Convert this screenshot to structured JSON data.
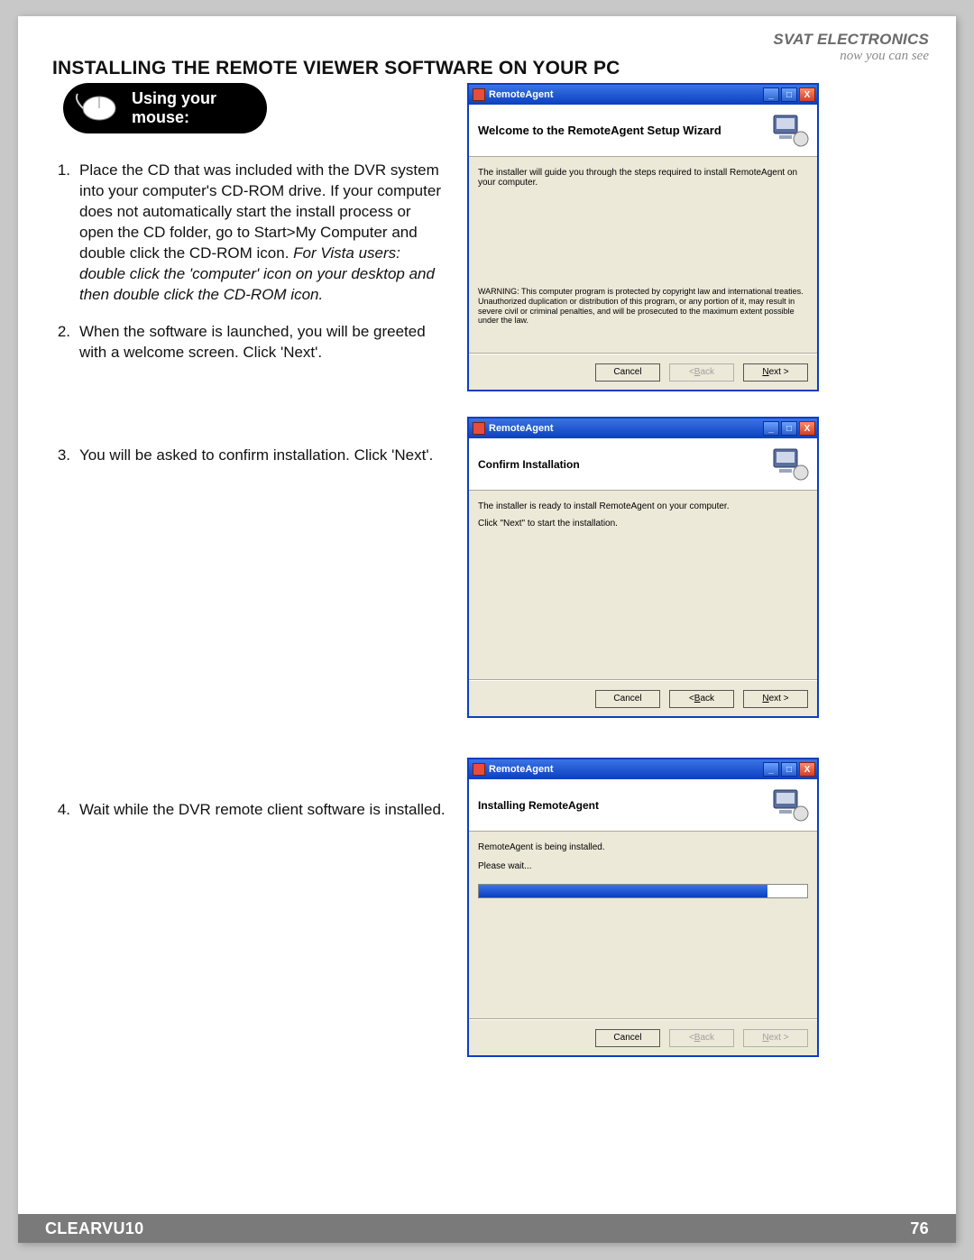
{
  "brand": {
    "name": "SVAT ELECTRONICS",
    "tagline": "now you can see"
  },
  "heading": "INSTALLING THE REMOTE VIEWER SOFTWARE ON YOUR PC",
  "mouse_badge": {
    "line1": "Using your",
    "line2": "mouse:"
  },
  "steps": {
    "s1_num": "1.",
    "s1a": "Place the CD that was included with the DVR system into your computer's CD-ROM drive.  If your computer does not automatically start the install process or open the CD folder, go to Start>My Computer and double click the CD-ROM icon.  ",
    "s1b": "For Vista users: double click the 'computer' icon on your desktop and then double click the CD-ROM icon.",
    "s2_num": "2.",
    "s2": "When the software is launched, you will be greeted with a welcome screen.  Click 'Next'.",
    "s3_num": "3.",
    "s3": "You will be asked to confirm installation.  Click 'Next'.",
    "s4_num": "4.",
    "s4": "Wait while the DVR remote client software is installed."
  },
  "dialogs": {
    "app_title": "RemoteAgent",
    "d1": {
      "header": "Welcome to the RemoteAgent Setup Wizard",
      "body": "The installer will guide you through the steps required to install RemoteAgent on your computer.",
      "warning": "WARNING: This computer program is protected by copyright law and international treaties. Unauthorized duplication or distribution of this program, or any portion of it, may result in severe civil or criminal penalties, and will be prosecuted to the maximum extent possible under the law."
    },
    "d2": {
      "header": "Confirm Installation",
      "body1": "The installer is ready to install RemoteAgent on your computer.",
      "body2": "Click \"Next\" to start the installation."
    },
    "d3": {
      "header": "Installing RemoteAgent",
      "body": "RemoteAgent is being installed.",
      "please_wait": "Please wait...",
      "progress_pct": 88
    },
    "buttons": {
      "cancel": "Cancel",
      "back_prefix": "< ",
      "back_u": "B",
      "back_suffix": "ack",
      "next_u": "N",
      "next_suffix": "ext >"
    }
  },
  "footer": {
    "model": "CLEARVU10",
    "page": "76"
  }
}
